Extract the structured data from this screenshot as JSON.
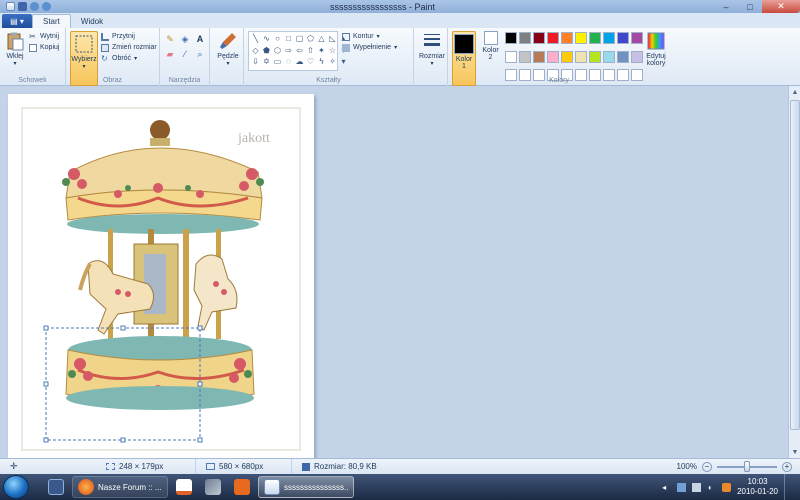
{
  "window": {
    "title": "sssssssssssssssss - Paint"
  },
  "tabs": [
    {
      "label": "Start"
    },
    {
      "label": "Widok"
    }
  ],
  "ribbon": {
    "clipboard": {
      "group": "Schowek",
      "paste": "Wklej",
      "cut": "Wytnij",
      "copy": "Kopiuj"
    },
    "image": {
      "group": "Obraz",
      "select": "Wybierz",
      "crop": "Przytnij",
      "resize": "Zmień rozmiar",
      "rotate": "Obróć"
    },
    "tools": {
      "group": "Narzędzia"
    },
    "brushes": {
      "label": "Pędzle"
    },
    "shapes": {
      "group": "Kształty",
      "outline": "Kontur",
      "fill": "Wypełnienie"
    },
    "size": {
      "label": "Rozmiar"
    },
    "colors": {
      "group": "Kolory",
      "color1": "Kolor 1",
      "color2": "Kolor 2",
      "edit": "Edytuj kolory",
      "color1_value": "#000000",
      "color2_value": "#ffffff",
      "palette": [
        "#000000",
        "#7f7f7f",
        "#880015",
        "#ed1c24",
        "#ff7f27",
        "#fff200",
        "#22b14c",
        "#00a2e8",
        "#3f48cc",
        "#a349a4",
        "#ffffff",
        "#c3c3c3",
        "#b97a57",
        "#ffaec9",
        "#ffc90e",
        "#efe4b0",
        "#b5e61d",
        "#99d9ea",
        "#7092be",
        "#c8bfe7",
        "#ffffff",
        "#ffffff",
        "#ffffff",
        "#ffffff",
        "#ffffff",
        "#ffffff",
        "#ffffff",
        "#ffffff",
        "#ffffff",
        "#ffffff"
      ]
    }
  },
  "canvas": {
    "watermark": "jakott"
  },
  "status": {
    "selection": "248 × 179px",
    "image_size": "580 × 680px",
    "file_size": "Rozmiar: 80,9 KB",
    "zoom": "100%"
  },
  "taskbar": {
    "forum": "Nasze Forum :: ...",
    "paint": "sssssssssssssss...",
    "time": "10:03",
    "date": "2010-01-20"
  }
}
